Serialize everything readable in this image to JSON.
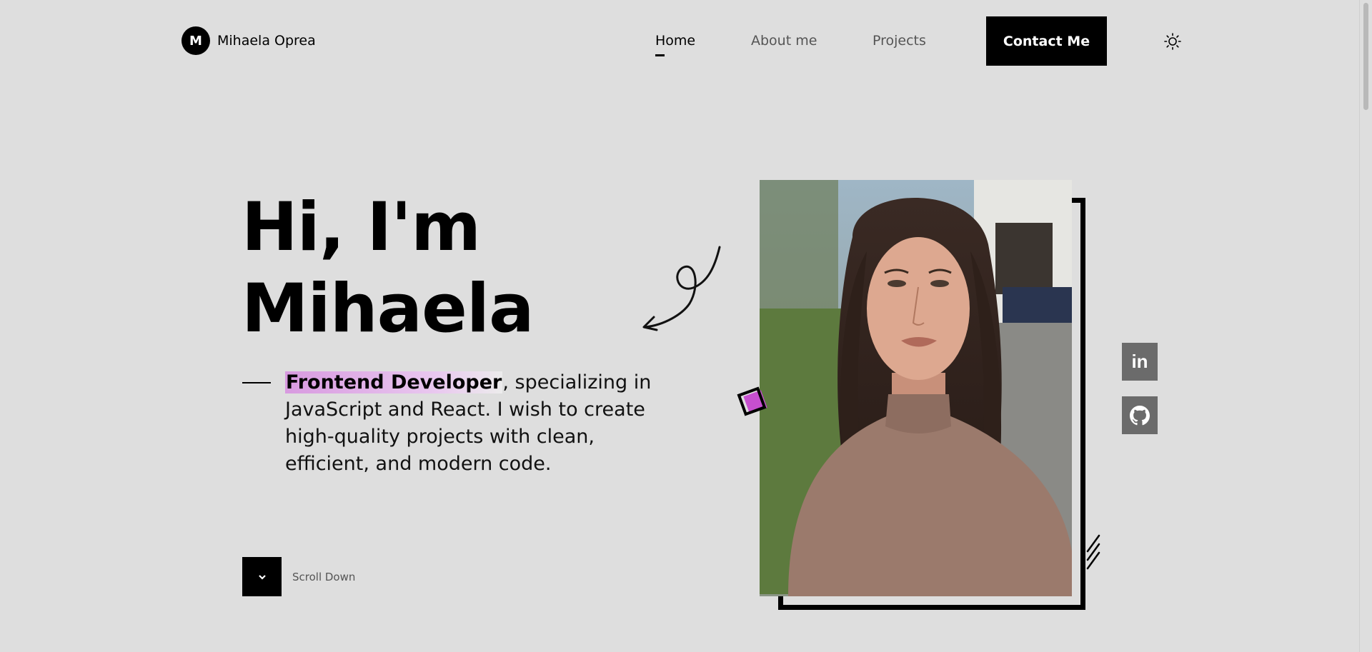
{
  "header": {
    "logo_letter": "M",
    "logo_name": "Mihaela Oprea",
    "nav": [
      {
        "label": "Home",
        "active": true
      },
      {
        "label": "About me",
        "active": false
      },
      {
        "label": "Projects",
        "active": false
      }
    ],
    "contact_label": "Contact Me",
    "theme_icon": "sun-icon"
  },
  "hero": {
    "title_line1": "Hi, I'm",
    "title_line2": "Mihaela",
    "role": "Frontend Developer",
    "description": ", specializing in JavaScript and React. I wish to create high-quality projects with clean, efficient, and modern code.",
    "scroll_label": "Scroll Down"
  },
  "social": {
    "linkedin_label": "in",
    "github_icon": "github-icon"
  },
  "colors": {
    "background": "#dedede",
    "accent": "#c64fcf",
    "button": "#000000",
    "social_bg": "#6b6b6b"
  }
}
